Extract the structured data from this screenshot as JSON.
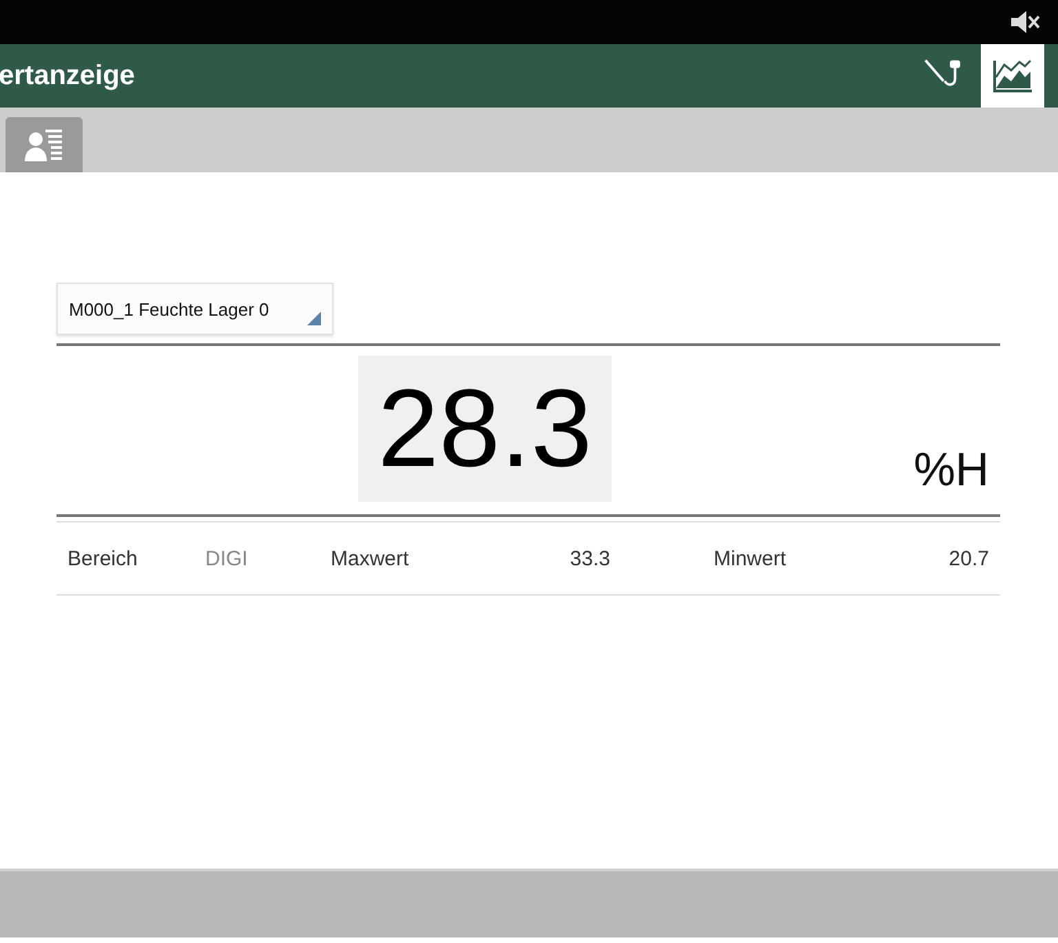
{
  "app_bar": {
    "title": "ertanzeige",
    "tabs": [
      {
        "kind": "probe",
        "selected": false
      },
      {
        "kind": "chart",
        "selected": true
      }
    ]
  },
  "measurement": {
    "channel": "M000_1 Feuchte Lager 0",
    "value": "28.3",
    "unit": "%H",
    "stats": [
      {
        "label": "Bereich",
        "value": "DIGI",
        "kind": "mode"
      },
      {
        "label": "Maxwert",
        "value": "33.3",
        "kind": "number"
      },
      {
        "label": "Minwert",
        "value": "20.7",
        "kind": "number"
      }
    ]
  }
}
